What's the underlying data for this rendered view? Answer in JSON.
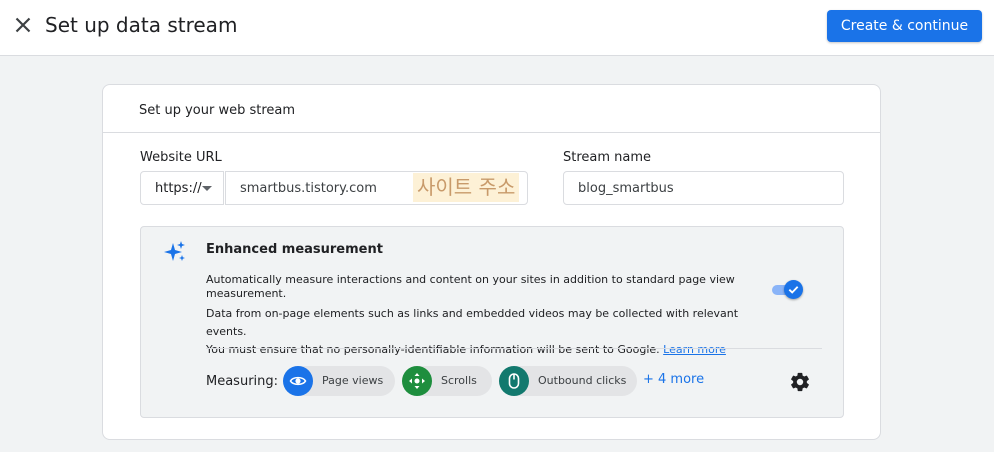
{
  "header": {
    "title": "Set up data stream",
    "primary_button": "Create & continue"
  },
  "card": {
    "title": "Set up your web stream",
    "website_url": {
      "label": "Website URL",
      "protocol": "https://",
      "value": "smartbus.tistory.com",
      "annotation": "사이트 주소"
    },
    "stream_name": {
      "label": "Stream name",
      "value": "blog_smartbus"
    },
    "enhanced": {
      "title": "Enhanced measurement",
      "description": "Automatically measure interactions and content on your sites in addition to standard page view measurement.",
      "note_line1": "Data from on-page elements such as links and embedded videos may be collected with relevant events.",
      "note_line2": "You must ensure that no personally-identifiable information will be sent to Google.",
      "learn_more": "Learn more",
      "toggle_on": true,
      "measuring_label": "Measuring:",
      "chips": [
        {
          "label": "Page views",
          "icon": "eye-icon",
          "color": "#1a73e8"
        },
        {
          "label": "Scrolls",
          "icon": "crosshair-icon",
          "color": "#1e8e3e"
        },
        {
          "label": "Outbound clicks",
          "icon": "mouse-icon",
          "color": "#12796e"
        }
      ],
      "more_link": "+ 4 more"
    }
  },
  "colors": {
    "accent": "#1a73e8",
    "background": "#f1f3f4",
    "annotation_bg": "#fdf1d6",
    "annotation_text": "#c89a6a"
  }
}
